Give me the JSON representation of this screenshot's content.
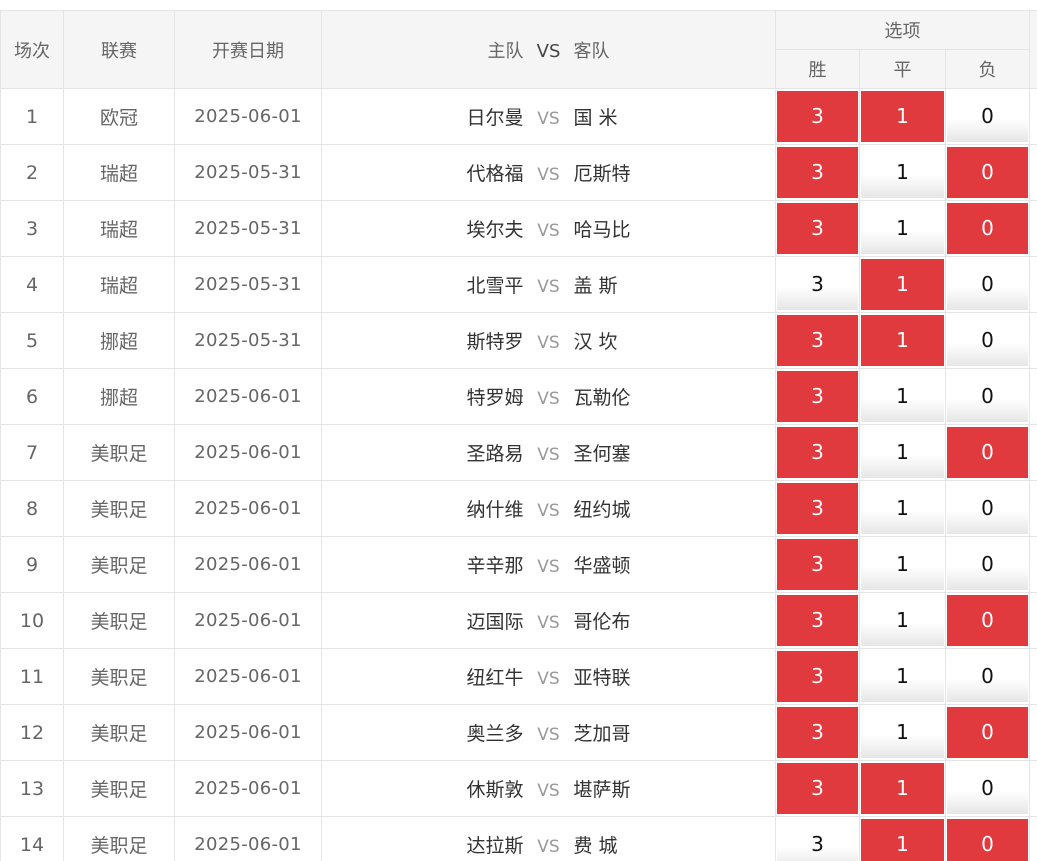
{
  "header": {
    "col_index": "场次",
    "col_league": "联赛",
    "col_date": "开赛日期",
    "col_home": "主队",
    "col_vs": "VS",
    "col_away": "客队",
    "col_options": "选项",
    "opt_win": "胜",
    "opt_draw": "平",
    "opt_lose": "负"
  },
  "rows": [
    {
      "index": "1",
      "league": "欧冠",
      "date": "2025-06-01",
      "home": "日尔曼",
      "vs": "VS",
      "away": "国 米",
      "win": "3",
      "draw": "1",
      "lose": "0",
      "win_selected": true,
      "draw_selected": true,
      "lose_selected": false
    },
    {
      "index": "2",
      "league": "瑞超",
      "date": "2025-05-31",
      "home": "代格福",
      "vs": "VS",
      "away": "厄斯特",
      "win": "3",
      "draw": "1",
      "lose": "0",
      "win_selected": true,
      "draw_selected": false,
      "lose_selected": true
    },
    {
      "index": "3",
      "league": "瑞超",
      "date": "2025-05-31",
      "home": "埃尔夫",
      "vs": "VS",
      "away": "哈马比",
      "win": "3",
      "draw": "1",
      "lose": "0",
      "win_selected": true,
      "draw_selected": false,
      "lose_selected": true
    },
    {
      "index": "4",
      "league": "瑞超",
      "date": "2025-05-31",
      "home": "北雪平",
      "vs": "VS",
      "away": "盖 斯",
      "win": "3",
      "draw": "1",
      "lose": "0",
      "win_selected": false,
      "draw_selected": true,
      "lose_selected": false
    },
    {
      "index": "5",
      "league": "挪超",
      "date": "2025-05-31",
      "home": "斯特罗",
      "vs": "VS",
      "away": "汉 坎",
      "win": "3",
      "draw": "1",
      "lose": "0",
      "win_selected": true,
      "draw_selected": true,
      "lose_selected": false
    },
    {
      "index": "6",
      "league": "挪超",
      "date": "2025-06-01",
      "home": "特罗姆",
      "vs": "VS",
      "away": "瓦勒伦",
      "win": "3",
      "draw": "1",
      "lose": "0",
      "win_selected": true,
      "draw_selected": false,
      "lose_selected": false
    },
    {
      "index": "7",
      "league": "美职足",
      "date": "2025-06-01",
      "home": "圣路易",
      "vs": "VS",
      "away": "圣何塞",
      "win": "3",
      "draw": "1",
      "lose": "0",
      "win_selected": true,
      "draw_selected": false,
      "lose_selected": true
    },
    {
      "index": "8",
      "league": "美职足",
      "date": "2025-06-01",
      "home": "纳什维",
      "vs": "VS",
      "away": "纽约城",
      "win": "3",
      "draw": "1",
      "lose": "0",
      "win_selected": true,
      "draw_selected": false,
      "lose_selected": false
    },
    {
      "index": "9",
      "league": "美职足",
      "date": "2025-06-01",
      "home": "辛辛那",
      "vs": "VS",
      "away": "华盛顿",
      "win": "3",
      "draw": "1",
      "lose": "0",
      "win_selected": true,
      "draw_selected": false,
      "lose_selected": false
    },
    {
      "index": "10",
      "league": "美职足",
      "date": "2025-06-01",
      "home": "迈国际",
      "vs": "VS",
      "away": "哥伦布",
      "win": "3",
      "draw": "1",
      "lose": "0",
      "win_selected": true,
      "draw_selected": false,
      "lose_selected": true
    },
    {
      "index": "11",
      "league": "美职足",
      "date": "2025-06-01",
      "home": "纽红牛",
      "vs": "VS",
      "away": "亚特联",
      "win": "3",
      "draw": "1",
      "lose": "0",
      "win_selected": true,
      "draw_selected": false,
      "lose_selected": false
    },
    {
      "index": "12",
      "league": "美职足",
      "date": "2025-06-01",
      "home": "奥兰多",
      "vs": "VS",
      "away": "芝加哥",
      "win": "3",
      "draw": "1",
      "lose": "0",
      "win_selected": true,
      "draw_selected": false,
      "lose_selected": true
    },
    {
      "index": "13",
      "league": "美职足",
      "date": "2025-06-01",
      "home": "休斯敦",
      "vs": "VS",
      "away": "堪萨斯",
      "win": "3",
      "draw": "1",
      "lose": "0",
      "win_selected": true,
      "draw_selected": true,
      "lose_selected": false
    },
    {
      "index": "14",
      "league": "美职足",
      "date": "2025-06-01",
      "home": "达拉斯",
      "vs": "VS",
      "away": "费 城",
      "win": "3",
      "draw": "1",
      "lose": "0",
      "win_selected": false,
      "draw_selected": true,
      "lose_selected": true
    }
  ],
  "colors": {
    "selected_bg": "#e0393e",
    "header_bg": "#f5f5f5",
    "border": "#e4e4e4"
  }
}
